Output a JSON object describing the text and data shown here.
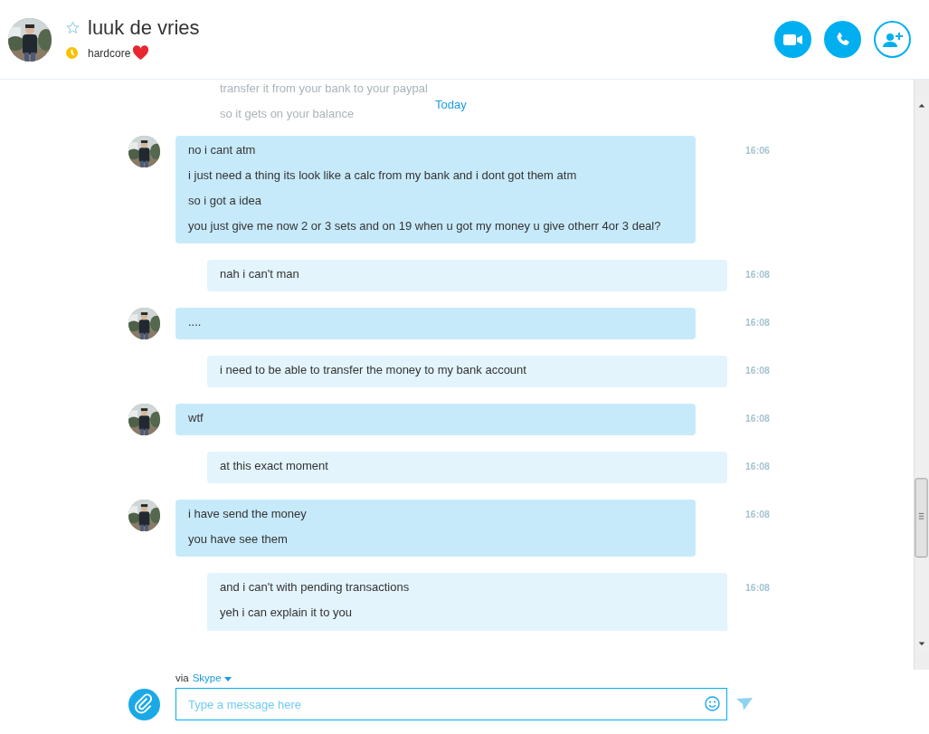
{
  "contact": {
    "name": "luuk de vries",
    "favorite": false,
    "mood": "hardcore"
  },
  "header_buttons": [
    {
      "kind": "video"
    },
    {
      "kind": "call"
    },
    {
      "kind": "add"
    }
  ],
  "faded_lines": [
    "transfer it from your bank to your paypal",
    "so it gets on your balance"
  ],
  "date_divider": "Today",
  "messages": [
    {
      "kind": "incoming",
      "lines": [
        "no i cant atm",
        "i just need a thing its look like a calc from my bank and i dont got them atm",
        "so i got a idea",
        "you just give me now 2 or 3 sets and on 19 when u got my money u give otherr 4or 3 deal?"
      ],
      "time": "16:06"
    },
    {
      "kind": "outgoing",
      "lines": [
        "nah i can't man"
      ],
      "time": "16:08"
    },
    {
      "kind": "incoming",
      "lines": [
        "...."
      ],
      "time": "16:08"
    },
    {
      "kind": "outgoing",
      "lines": [
        "i need to be able to transfer the money to my bank account"
      ],
      "time": "16:08"
    },
    {
      "kind": "incoming",
      "lines": [
        "wtf"
      ],
      "time": "16:08"
    },
    {
      "kind": "outgoing",
      "lines": [
        "at this exact moment"
      ],
      "time": "16:08"
    },
    {
      "kind": "incoming",
      "lines": [
        "i have send the money",
        "you have see them"
      ],
      "time": "16:08"
    },
    {
      "kind": "outgoing",
      "lines": [
        "and i can't with pending transactions",
        "yeh i can explain it to you"
      ],
      "time": "16:08"
    }
  ],
  "composer": {
    "via_label": "via",
    "service": "Skype",
    "placeholder": "Type a message here"
  }
}
